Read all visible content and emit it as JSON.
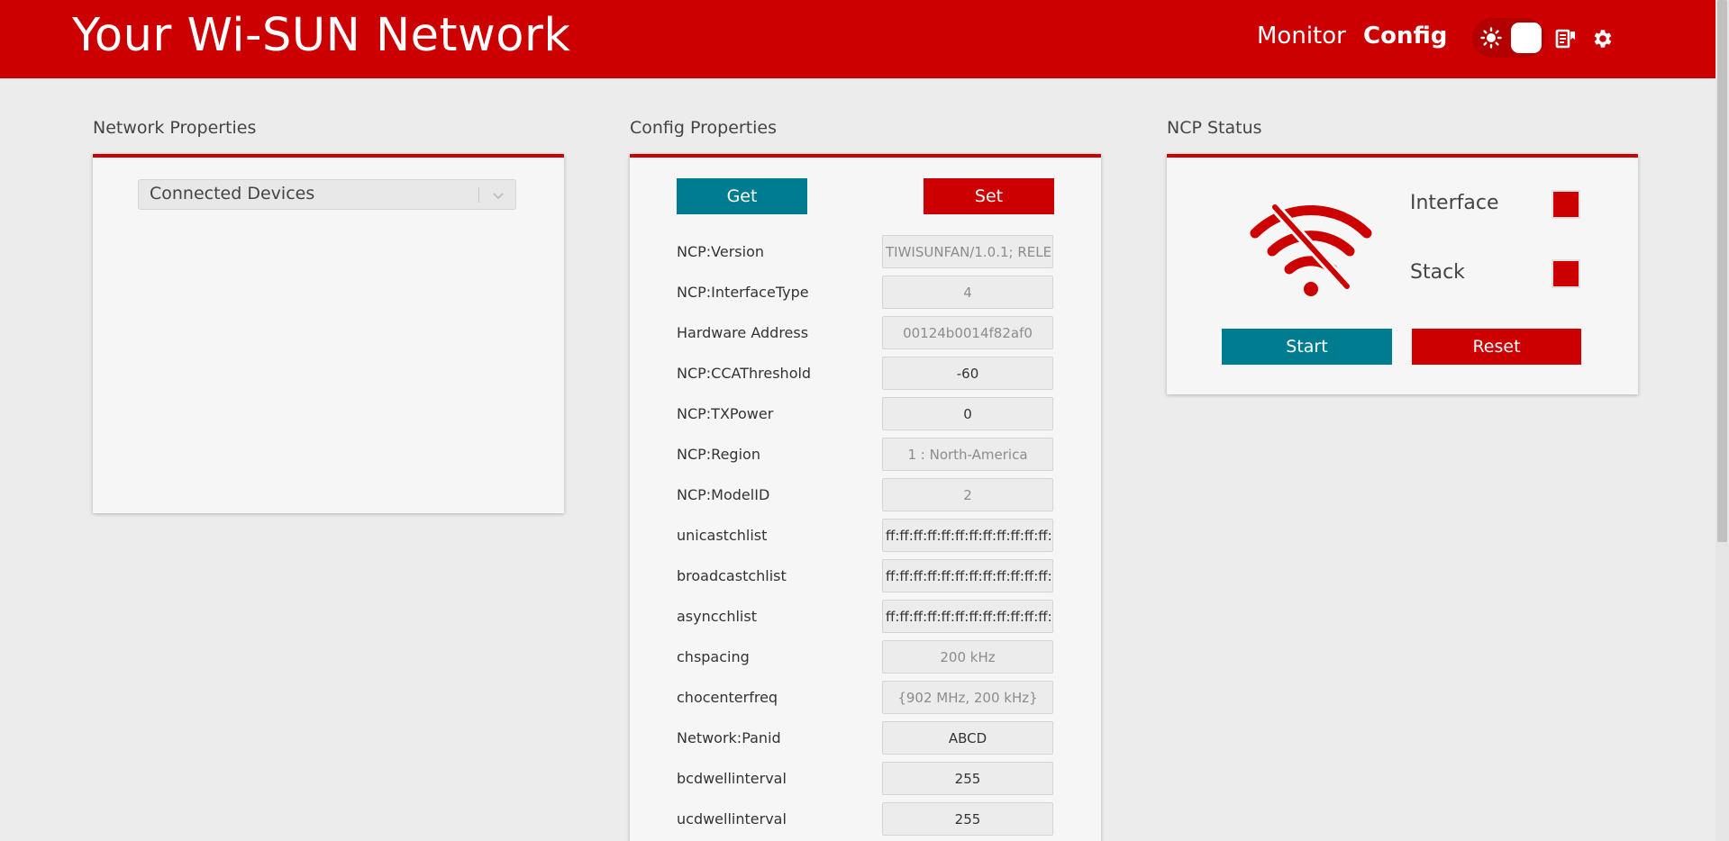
{
  "app": {
    "title": "Your Wi-SUN Network"
  },
  "nav": {
    "monitor": "Monitor",
    "config": "Config"
  },
  "icons": {
    "theme": "sun-icon",
    "docs": "document-icon",
    "settings": "gear-icon",
    "status": "wifi-off-icon"
  },
  "colors": {
    "brand": "#cc0000",
    "teal": "#007c91",
    "background": "#ececec",
    "card": "#f6f6f6"
  },
  "network_properties": {
    "title": "Network Properties",
    "select_value": "Connected Devices"
  },
  "config_properties": {
    "title": "Config Properties",
    "get_label": "Get",
    "set_label": "Set",
    "rows": [
      {
        "label": "NCP:Version",
        "value": "TIWISUNFAN/1.0.1; RELE"
      },
      {
        "label": "NCP:InterfaceType",
        "value": "4"
      },
      {
        "label": "Hardware Address",
        "value": "00124b0014f82af0"
      },
      {
        "label": "NCP:CCAThreshold",
        "value": "-60"
      },
      {
        "label": "NCP:TXPower",
        "value": "0"
      },
      {
        "label": "NCP:Region",
        "value": "1 : North-America"
      },
      {
        "label": "NCP:ModelID",
        "value": "2"
      },
      {
        "label": "unicastchlist",
        "value": "ff:ff:ff:ff:ff:ff:ff:ff:ff:ff:ff:ff:ff:ff:ff:ff"
      },
      {
        "label": "broadcastchlist",
        "value": "ff:ff:ff:ff:ff:ff:ff:ff:ff:ff:ff:ff:ff:ff:ff:ff"
      },
      {
        "label": "asyncchlist",
        "value": "ff:ff:ff:ff:ff:ff:ff:ff:ff:ff:ff:ff:ff:ff:ff:ff"
      },
      {
        "label": "chspacing",
        "value": "200 kHz"
      },
      {
        "label": "chocenterfreq",
        "value": "{902 MHz, 200 kHz}"
      },
      {
        "label": "Network:Panid",
        "value": "ABCD"
      },
      {
        "label": "bcdwellinterval",
        "value": "255"
      },
      {
        "label": "ucdwellinterval",
        "value": "255"
      }
    ]
  },
  "ncp_status": {
    "title": "NCP Status",
    "interface_label": "Interface",
    "stack_label": "Stack",
    "start_label": "Start",
    "reset_label": "Reset"
  }
}
